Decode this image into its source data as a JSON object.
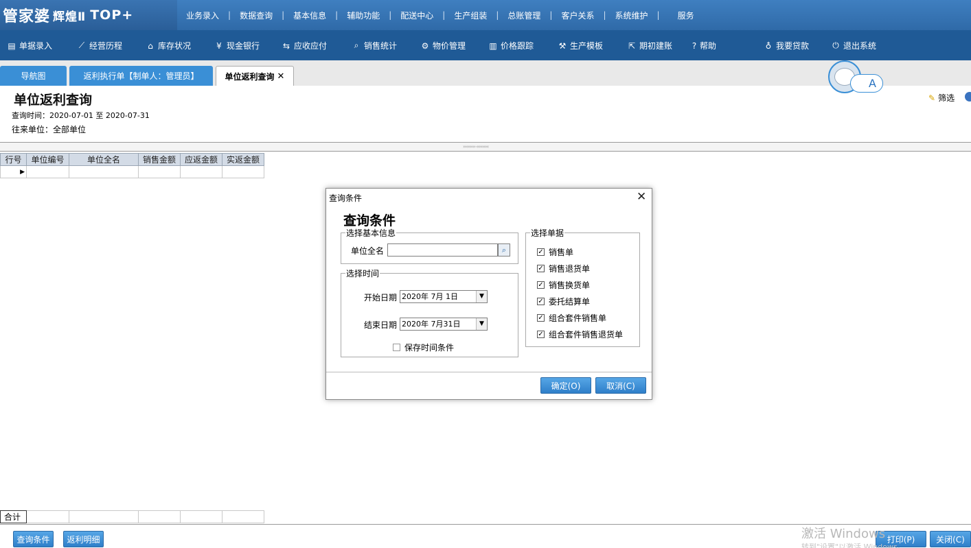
{
  "app": {
    "logo_main": "管家婆",
    "logo_sub": "辉煌Ⅱ",
    "logo_top": "TOP+"
  },
  "top_menu": [
    "业务录入",
    "数据查询",
    "基本信息",
    "辅助功能",
    "配送中心",
    "生产组装",
    "总账管理",
    "客户关系",
    "系统维护",
    "服务"
  ],
  "toolbar": [
    {
      "label": "单据录入",
      "icon": "document-icon"
    },
    {
      "label": "经营历程",
      "icon": "chart-line-icon"
    },
    {
      "label": "库存状况",
      "icon": "home-icon"
    },
    {
      "label": "现金银行",
      "icon": "yen-icon"
    },
    {
      "label": "应收应付",
      "icon": "exchange-icon"
    },
    {
      "label": "销售统计",
      "icon": "search-icon"
    },
    {
      "label": "物价管理",
      "icon": "gear-icon"
    },
    {
      "label": "价格跟踪",
      "icon": "bar-chart-icon"
    },
    {
      "label": "生产模板",
      "icon": "wrench-icon"
    },
    {
      "label": "期初建账",
      "icon": "external-link-icon"
    },
    {
      "label": "帮助",
      "icon": "question-icon"
    },
    {
      "label": "我要贷款",
      "icon": "money-bag-icon"
    },
    {
      "label": "退出系统",
      "icon": "power-icon"
    }
  ],
  "tabs": [
    {
      "label": "导航图"
    },
    {
      "label": "返利执行单【制单人：管理员】"
    },
    {
      "label": "单位返利查询"
    }
  ],
  "avatar_letter": "A",
  "page": {
    "title": "单位返利查询",
    "query_time_label": "查询时间：",
    "query_time_range": "2020-07-01 至 2020-07-31",
    "unit_label": "往来单位：",
    "unit_value": "全部单位",
    "filter_label": "筛选"
  },
  "grid": {
    "columns": [
      "行号",
      "单位编号",
      "单位全名",
      "销售金额",
      "应返金额",
      "实返金额"
    ],
    "total_label": "合计"
  },
  "bottom_buttons": {
    "query": "查询条件",
    "detail": "返利明细",
    "print": "打印(P)",
    "close": "关闭(C)"
  },
  "watermark": {
    "line1": "激活 Windows",
    "line2": "转到\"设置\"以激活 Windows。"
  },
  "dialog": {
    "title": "查询条件",
    "heading": "查询条件",
    "basic_group": "选择基本信息",
    "unit_fullname_label": "单位全名",
    "unit_fullname_value": "",
    "time_group": "选择时间",
    "start_label": "开始日期",
    "start_value": "2020年  7月  1日",
    "end_label": "结束日期",
    "end_value": "2020年  7月31日",
    "save_time_label": "保存时间条件",
    "save_time_checked": false,
    "doc_group": "选择单据",
    "doc_types": [
      {
        "label": "销售单",
        "checked": true
      },
      {
        "label": "销售退货单",
        "checked": true
      },
      {
        "label": "销售换货单",
        "checked": true
      },
      {
        "label": "委托结算单",
        "checked": true
      },
      {
        "label": "组合套件销售单",
        "checked": true
      },
      {
        "label": "组合套件销售退货单",
        "checked": true
      }
    ],
    "ok_label": "确定(O)",
    "cancel_label": "取消(C)"
  }
}
